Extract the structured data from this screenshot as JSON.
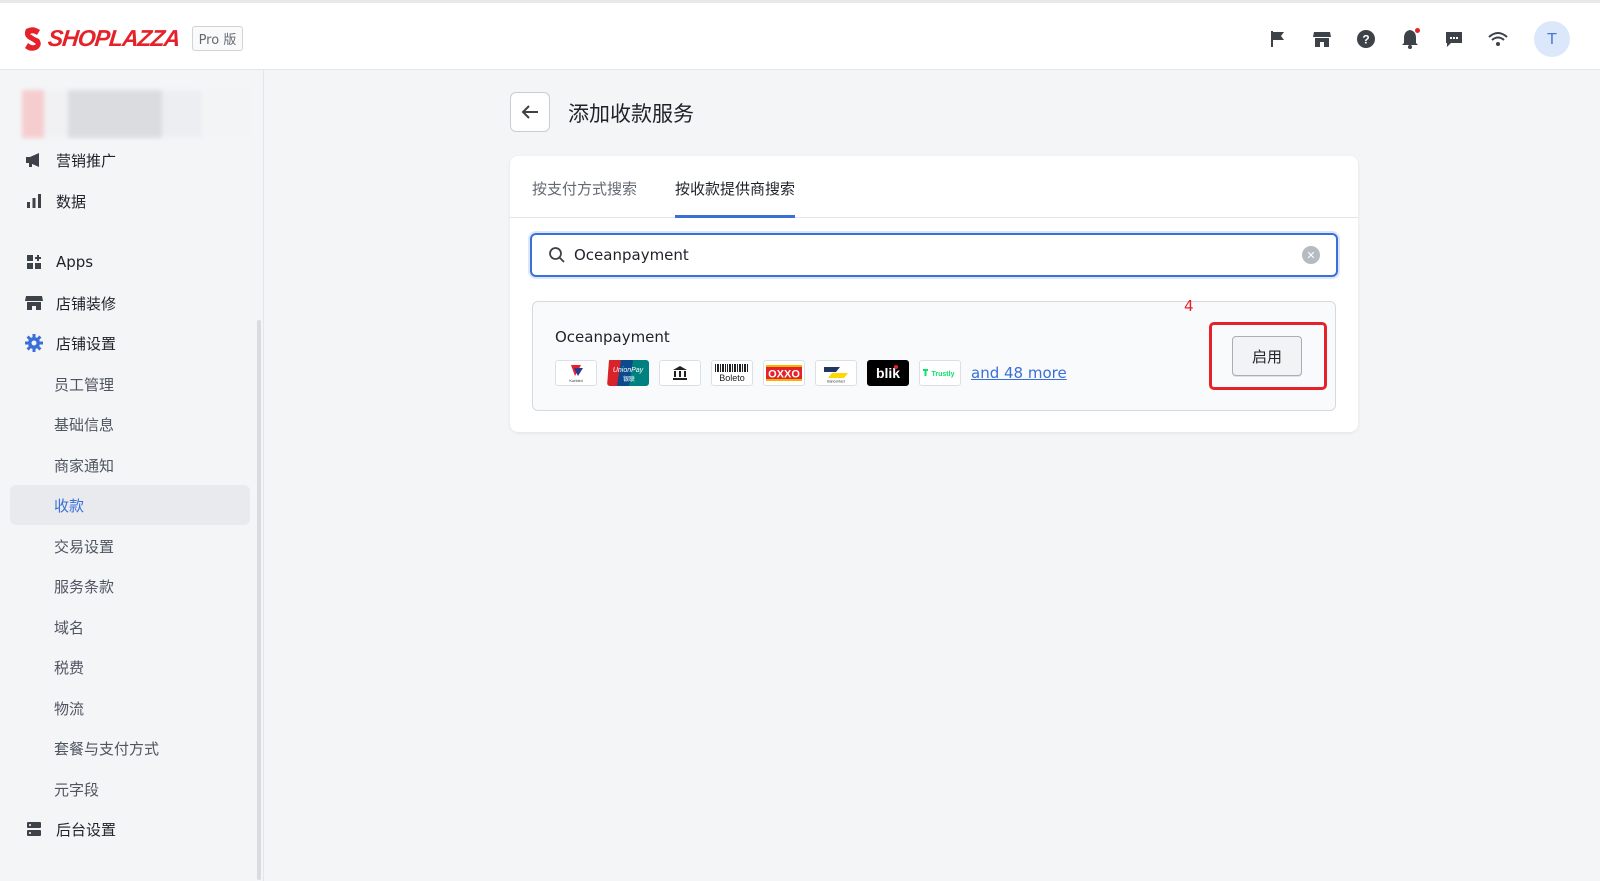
{
  "header": {
    "brand": "SHOPLAZZA",
    "plan_badge": "Pro 版",
    "icons": [
      "flag-icon",
      "store-icon",
      "help-icon",
      "bell-icon",
      "chat-icon",
      "wifi-icon"
    ],
    "avatar_initial": "T"
  },
  "sidebar": {
    "items": [
      {
        "label": "营销推广",
        "icon": "megaphone-icon"
      },
      {
        "label": "数据",
        "icon": "bar-chart-icon"
      },
      {
        "label": "Apps",
        "icon": "apps-icon"
      },
      {
        "label": "店铺装修",
        "icon": "storefront-icon"
      },
      {
        "label": "店铺设置",
        "icon": "gear-icon"
      },
      {
        "label": "员工管理"
      },
      {
        "label": "基础信息"
      },
      {
        "label": "商家通知"
      },
      {
        "label": "收款"
      },
      {
        "label": "交易设置"
      },
      {
        "label": "服务条款"
      },
      {
        "label": "域名"
      },
      {
        "label": "税费"
      },
      {
        "label": "物流"
      },
      {
        "label": "套餐与支付方式"
      },
      {
        "label": "元字段"
      },
      {
        "label": "后台设置",
        "icon": "server-icon"
      }
    ],
    "active_item": "收款"
  },
  "main": {
    "title": "添加收款服务",
    "tabs": [
      {
        "label": "按支付方式搜索",
        "active": false
      },
      {
        "label": "按收款提供商搜索",
        "active": true
      }
    ],
    "search": {
      "value": "Oceanpayment"
    },
    "provider": {
      "name": "Oceanpayment",
      "payment_methods": [
        "Konbini",
        "UnionPay 银联",
        "Bank",
        "Boleto",
        "OXXO",
        "Bancontact",
        "blik",
        "Trustly"
      ],
      "more_link": "and 48 more",
      "enable_label": "启用",
      "annotation": "4"
    }
  },
  "colors": {
    "brand": "#e5222a",
    "accent": "#3a6fd8"
  }
}
